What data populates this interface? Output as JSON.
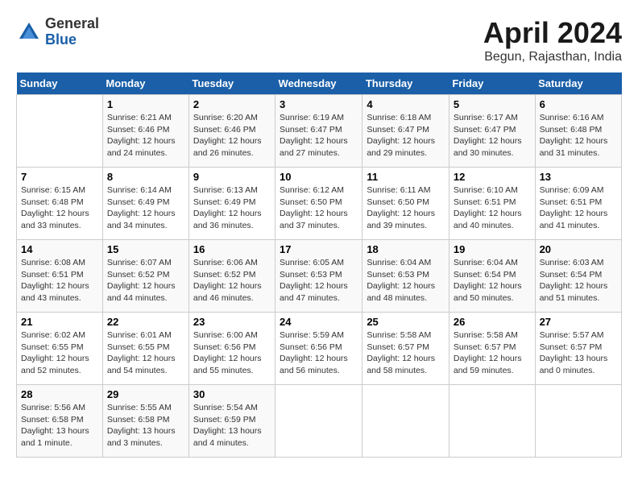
{
  "header": {
    "logo_line1": "General",
    "logo_line2": "Blue",
    "month": "April 2024",
    "location": "Begun, Rajasthan, India"
  },
  "weekdays": [
    "Sunday",
    "Monday",
    "Tuesday",
    "Wednesday",
    "Thursday",
    "Friday",
    "Saturday"
  ],
  "weeks": [
    [
      {
        "num": "",
        "info": ""
      },
      {
        "num": "1",
        "info": "Sunrise: 6:21 AM\nSunset: 6:46 PM\nDaylight: 12 hours\nand 24 minutes."
      },
      {
        "num": "2",
        "info": "Sunrise: 6:20 AM\nSunset: 6:46 PM\nDaylight: 12 hours\nand 26 minutes."
      },
      {
        "num": "3",
        "info": "Sunrise: 6:19 AM\nSunset: 6:47 PM\nDaylight: 12 hours\nand 27 minutes."
      },
      {
        "num": "4",
        "info": "Sunrise: 6:18 AM\nSunset: 6:47 PM\nDaylight: 12 hours\nand 29 minutes."
      },
      {
        "num": "5",
        "info": "Sunrise: 6:17 AM\nSunset: 6:47 PM\nDaylight: 12 hours\nand 30 minutes."
      },
      {
        "num": "6",
        "info": "Sunrise: 6:16 AM\nSunset: 6:48 PM\nDaylight: 12 hours\nand 31 minutes."
      }
    ],
    [
      {
        "num": "7",
        "info": "Sunrise: 6:15 AM\nSunset: 6:48 PM\nDaylight: 12 hours\nand 33 minutes."
      },
      {
        "num": "8",
        "info": "Sunrise: 6:14 AM\nSunset: 6:49 PM\nDaylight: 12 hours\nand 34 minutes."
      },
      {
        "num": "9",
        "info": "Sunrise: 6:13 AM\nSunset: 6:49 PM\nDaylight: 12 hours\nand 36 minutes."
      },
      {
        "num": "10",
        "info": "Sunrise: 6:12 AM\nSunset: 6:50 PM\nDaylight: 12 hours\nand 37 minutes."
      },
      {
        "num": "11",
        "info": "Sunrise: 6:11 AM\nSunset: 6:50 PM\nDaylight: 12 hours\nand 39 minutes."
      },
      {
        "num": "12",
        "info": "Sunrise: 6:10 AM\nSunset: 6:51 PM\nDaylight: 12 hours\nand 40 minutes."
      },
      {
        "num": "13",
        "info": "Sunrise: 6:09 AM\nSunset: 6:51 PM\nDaylight: 12 hours\nand 41 minutes."
      }
    ],
    [
      {
        "num": "14",
        "info": "Sunrise: 6:08 AM\nSunset: 6:51 PM\nDaylight: 12 hours\nand 43 minutes."
      },
      {
        "num": "15",
        "info": "Sunrise: 6:07 AM\nSunset: 6:52 PM\nDaylight: 12 hours\nand 44 minutes."
      },
      {
        "num": "16",
        "info": "Sunrise: 6:06 AM\nSunset: 6:52 PM\nDaylight: 12 hours\nand 46 minutes."
      },
      {
        "num": "17",
        "info": "Sunrise: 6:05 AM\nSunset: 6:53 PM\nDaylight: 12 hours\nand 47 minutes."
      },
      {
        "num": "18",
        "info": "Sunrise: 6:04 AM\nSunset: 6:53 PM\nDaylight: 12 hours\nand 48 minutes."
      },
      {
        "num": "19",
        "info": "Sunrise: 6:04 AM\nSunset: 6:54 PM\nDaylight: 12 hours\nand 50 minutes."
      },
      {
        "num": "20",
        "info": "Sunrise: 6:03 AM\nSunset: 6:54 PM\nDaylight: 12 hours\nand 51 minutes."
      }
    ],
    [
      {
        "num": "21",
        "info": "Sunrise: 6:02 AM\nSunset: 6:55 PM\nDaylight: 12 hours\nand 52 minutes."
      },
      {
        "num": "22",
        "info": "Sunrise: 6:01 AM\nSunset: 6:55 PM\nDaylight: 12 hours\nand 54 minutes."
      },
      {
        "num": "23",
        "info": "Sunrise: 6:00 AM\nSunset: 6:56 PM\nDaylight: 12 hours\nand 55 minutes."
      },
      {
        "num": "24",
        "info": "Sunrise: 5:59 AM\nSunset: 6:56 PM\nDaylight: 12 hours\nand 56 minutes."
      },
      {
        "num": "25",
        "info": "Sunrise: 5:58 AM\nSunset: 6:57 PM\nDaylight: 12 hours\nand 58 minutes."
      },
      {
        "num": "26",
        "info": "Sunrise: 5:58 AM\nSunset: 6:57 PM\nDaylight: 12 hours\nand 59 minutes."
      },
      {
        "num": "27",
        "info": "Sunrise: 5:57 AM\nSunset: 6:57 PM\nDaylight: 13 hours\nand 0 minutes."
      }
    ],
    [
      {
        "num": "28",
        "info": "Sunrise: 5:56 AM\nSunset: 6:58 PM\nDaylight: 13 hours\nand 1 minute."
      },
      {
        "num": "29",
        "info": "Sunrise: 5:55 AM\nSunset: 6:58 PM\nDaylight: 13 hours\nand 3 minutes."
      },
      {
        "num": "30",
        "info": "Sunrise: 5:54 AM\nSunset: 6:59 PM\nDaylight: 13 hours\nand 4 minutes."
      },
      {
        "num": "",
        "info": ""
      },
      {
        "num": "",
        "info": ""
      },
      {
        "num": "",
        "info": ""
      },
      {
        "num": "",
        "info": ""
      }
    ]
  ]
}
